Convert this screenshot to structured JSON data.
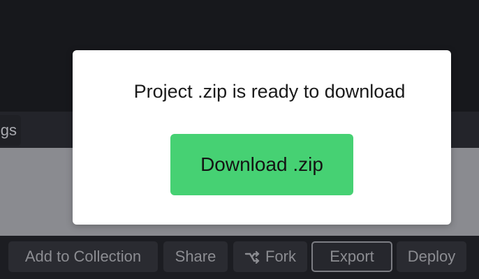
{
  "background": {
    "partial_tab_label": "gs",
    "toolbar": {
      "add_to_collection": "Add to Collection",
      "share": "Share",
      "fork": "Fork",
      "export": "Export",
      "deploy": "Deploy"
    }
  },
  "modal": {
    "message": "Project .zip is ready to download",
    "download_label": "Download .zip"
  },
  "colors": {
    "accent_green": "#46d173",
    "modal_bg": "#ffffff",
    "topbar_bg": "#17181c"
  },
  "icons": {
    "fork": "fork-icon"
  }
}
